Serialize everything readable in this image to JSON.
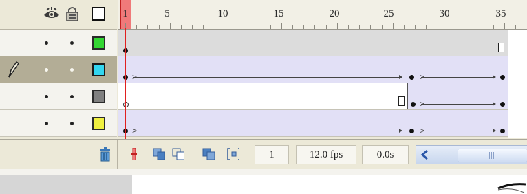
{
  "header": {
    "eye_icon": "eye-icon",
    "lock_icon": "lock-icon",
    "outline_icon": "outline-square-icon",
    "ruler_labels": [
      "1",
      "5",
      "10",
      "15",
      "20",
      "25",
      "30",
      "35"
    ]
  },
  "layers": [
    {
      "color": "#33d633",
      "selected": false
    },
    {
      "color": "#33d6f0",
      "selected": true,
      "edit_icon": "pencil-icon"
    },
    {
      "color": "#808080",
      "selected": false
    },
    {
      "color": "#f0f040",
      "selected": false
    }
  ],
  "footer": {
    "current_frame": "1",
    "fps": "12.0 fps",
    "elapsed": "0.0s",
    "trash_icon": "trash-icon",
    "scroll_left_icon": "chevron-left-icon"
  },
  "colors": {
    "playhead": "#e02020",
    "tween_fill": "#e2e0f6",
    "selected_layer": "#b3ad96"
  }
}
